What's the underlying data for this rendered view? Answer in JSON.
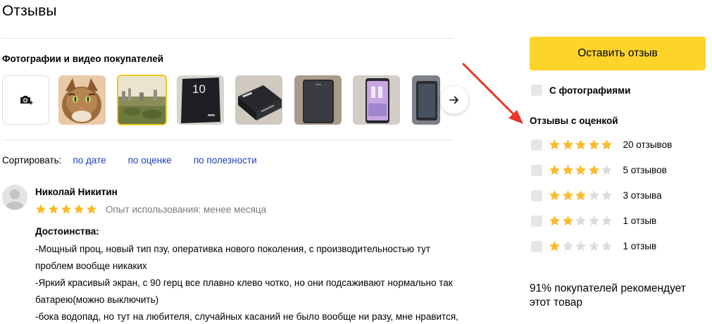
{
  "page": {
    "title": "Отзывы"
  },
  "media": {
    "heading": "Фотографии и видео покупателей",
    "add_photo_icon": "camera-plus-icon",
    "next_icon": "arrow-right-icon",
    "thumbnails": [
      {
        "name": "photo-cat"
      },
      {
        "name": "photo-city-view"
      },
      {
        "name": "photo-phone-box"
      },
      {
        "name": "photo-phone-box-side"
      },
      {
        "name": "photo-phone-back"
      },
      {
        "name": "photo-phone-screen"
      },
      {
        "name": "photo-phone-in-hand"
      }
    ]
  },
  "sort": {
    "label": "Сортировать:",
    "options": [
      "по дате",
      "по оценке",
      "по полезности"
    ]
  },
  "review": {
    "author": "Николай Никитин",
    "rating": 5,
    "experience": "Опыт использования: менее месяца",
    "pros_label": "Достоинства:",
    "lines": [
      "-Мощный проц, новый тип пзу, оперативка нового поколения, с производительностью тут",
      "проблем вообще никаких",
      "-Яркий красивый экран, с 90 герц все плавно клево чотко, но они подсаживают нормально так",
      "батарею(можно выключить)",
      "-бока водопад, но тут на любителя, случайных касаний не было вообще ни разу, мне нравится,"
    ]
  },
  "sidebar": {
    "cta_label": "Оставить отзыв",
    "photo_filter_label": "С фотографиями",
    "rating_heading": "Отзывы с оценкой",
    "ratings": [
      {
        "stars": 5,
        "label": "20 отзывов"
      },
      {
        "stars": 4,
        "label": "5 отзывов"
      },
      {
        "stars": 3,
        "label": "3 отзыва"
      },
      {
        "stars": 2,
        "label": "1 отзыв"
      },
      {
        "stars": 1,
        "label": "1 отзыв"
      }
    ],
    "recommend_text": "91% покупателей рекомендует этот товар"
  },
  "colors": {
    "accent_yellow": "#fed42b",
    "star_filled": "#fbbb2c",
    "star_empty": "#dcdcdc",
    "link_blue": "#1a3dc1",
    "annotation_red": "#e8372a"
  }
}
